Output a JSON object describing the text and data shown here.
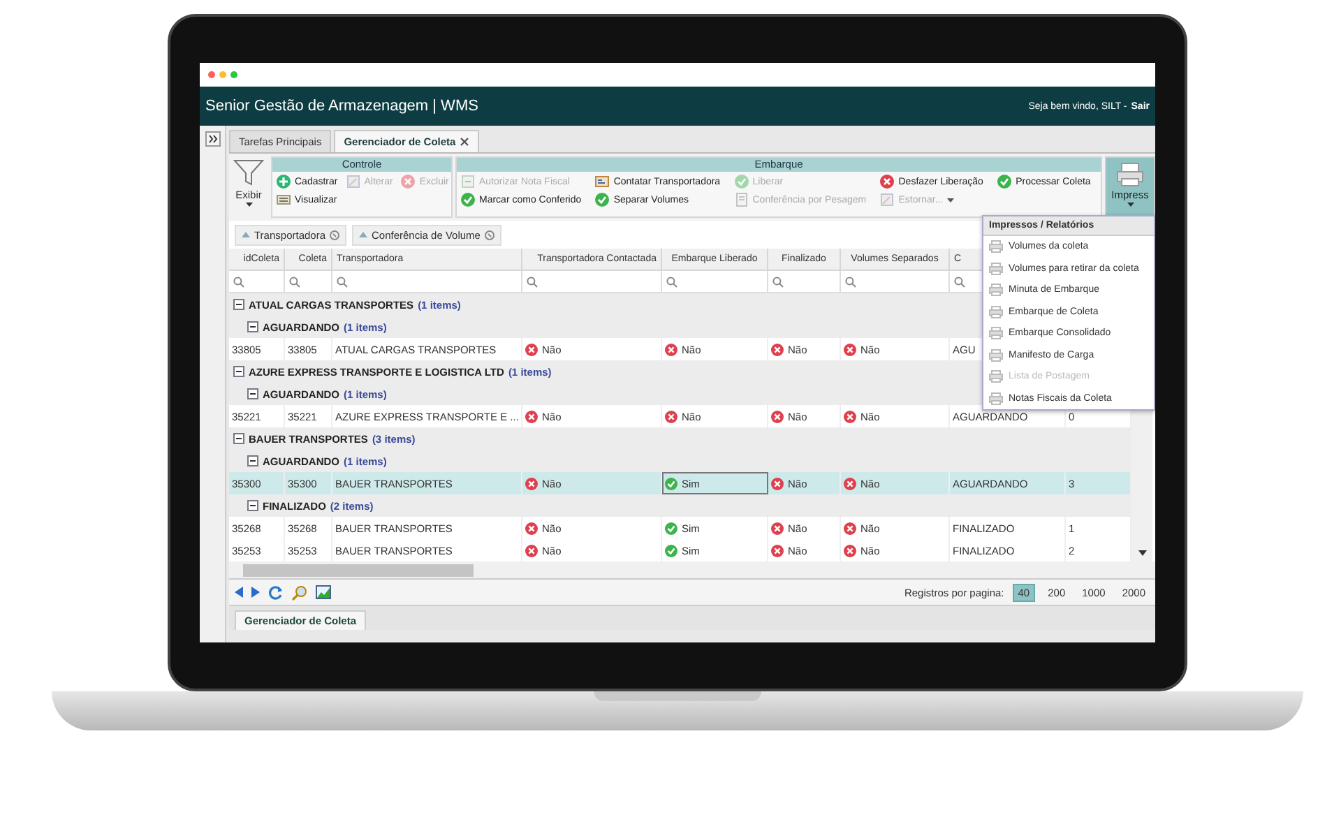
{
  "browser": {
    "dots": [
      {
        "color": "#ff5f57"
      },
      {
        "color": "#ffbd2e"
      },
      {
        "color": "#28c840"
      }
    ]
  },
  "app_header": {
    "title": "Senior Gestão de Armazenagem | WMS",
    "welcome": "Seja bem vindo, SILT -",
    "logout": "Sair"
  },
  "tabs": [
    {
      "label": "Tarefas Principais",
      "selected": false,
      "closable": false
    },
    {
      "label": "Gerenciador de Coleta",
      "selected": true,
      "closable": true
    }
  ],
  "toolbar": {
    "view_button": {
      "label": "Exibir"
    },
    "groups": [
      {
        "title": "Controle",
        "kind": "small",
        "actions": [
          {
            "label": "Cadastrar",
            "kind": "add",
            "disabled": false
          },
          {
            "label": "Alterar",
            "kind": "edit",
            "disabled": true
          },
          {
            "label": "Excluir",
            "kind": "remove",
            "disabled": true
          },
          {
            "label": "Visualizar",
            "kind": "view",
            "disabled": false
          }
        ]
      },
      {
        "title": "Embarque",
        "kind": "wide",
        "actions": [
          {
            "label": "Autorizar Nota Fiscal",
            "kind": "nota",
            "disabled": true
          },
          {
            "label": "Contatar Transportadora",
            "kind": "contact",
            "disabled": false
          },
          {
            "label": "Liberar",
            "kind": "check",
            "disabled": true
          },
          {
            "label": "Desfazer Liberação",
            "kind": "remove",
            "disabled": false
          },
          {
            "label": "Processar Coleta",
            "kind": "check",
            "disabled": false
          },
          {
            "label": "Marcar como Conferido",
            "kind": "check",
            "disabled": false
          },
          {
            "label": "Separar Volumes",
            "kind": "check",
            "disabled": false
          },
          {
            "label": "Conferência por Pesagem",
            "kind": "weigh",
            "disabled": true
          },
          {
            "label": "Estornar...",
            "kind": "edit",
            "disabled": true,
            "dropdown": true
          }
        ]
      }
    ],
    "print_button": {
      "label": "Impress",
      "expanded": true
    }
  },
  "print_menu": {
    "title": "Impressos / Relatórios",
    "items": [
      {
        "label": "Volumes da coleta",
        "disabled": false
      },
      {
        "label": "Volumes para retirar da coleta",
        "disabled": false
      },
      {
        "label": "Minuta de Embarque",
        "disabled": false
      },
      {
        "label": "Embarque de Coleta",
        "disabled": false
      },
      {
        "label": "Embarque Consolidado",
        "disabled": false
      },
      {
        "label": "Manifesto de Carga",
        "disabled": false
      },
      {
        "label": "Lista de Postagem",
        "disabled": true
      },
      {
        "label": "Notas Fiscais da Coleta",
        "disabled": false
      }
    ]
  },
  "grouping_chips": [
    {
      "label": "Transportadora"
    },
    {
      "label": "Conferência de Volume"
    }
  ],
  "table": {
    "columns": [
      {
        "label": "idColeta"
      },
      {
        "label": "Coleta"
      },
      {
        "label": "Transportadora"
      },
      {
        "label": "Transportadora Contactada"
      },
      {
        "label": "Embarque Liberado"
      },
      {
        "label": "Finalizado"
      },
      {
        "label": "Volumes Separados"
      },
      {
        "label": "C"
      }
    ],
    "groups": [
      {
        "name": "ATUAL CARGAS TRANSPORTES",
        "count": "(1 items)",
        "expanded": true,
        "children": [
          {
            "name": "AGUARDANDO",
            "count": "(1 items)",
            "expanded": true,
            "rows": [
              {
                "selected": false,
                "cells": [
                  {
                    "kind": "text",
                    "text": "33805"
                  },
                  {
                    "kind": "text",
                    "text": "33805"
                  },
                  {
                    "kind": "text",
                    "text": "ATUAL CARGAS TRANSPORTES"
                  },
                  {
                    "kind": "status",
                    "text": "Não",
                    "ok": false,
                    "focused": false
                  },
                  {
                    "kind": "status",
                    "text": "Não",
                    "ok": false,
                    "focused": false
                  },
                  {
                    "kind": "status",
                    "text": "Não",
                    "ok": false,
                    "focused": false
                  },
                  {
                    "kind": "status",
                    "text": "Não",
                    "ok": false,
                    "focused": false
                  },
                  {
                    "kind": "text",
                    "text": "AGU"
                  }
                ]
              }
            ]
          }
        ]
      },
      {
        "name": "AZURE EXPRESS TRANSPORTE E LOGISTICA LTD",
        "count": "(1 items)",
        "expanded": true,
        "children": [
          {
            "name": "AGUARDANDO",
            "count": "(1 items)",
            "expanded": true,
            "rows": [
              {
                "selected": false,
                "cells": [
                  {
                    "kind": "text",
                    "text": "35221"
                  },
                  {
                    "kind": "text",
                    "text": "35221"
                  },
                  {
                    "kind": "text",
                    "text": "AZURE EXPRESS TRANSPORTE E ..."
                  },
                  {
                    "kind": "status",
                    "text": "Não",
                    "ok": false,
                    "focused": false
                  },
                  {
                    "kind": "status",
                    "text": "Não",
                    "ok": false,
                    "focused": false
                  },
                  {
                    "kind": "status",
                    "text": "Não",
                    "ok": false,
                    "focused": false
                  },
                  {
                    "kind": "status",
                    "text": "Não",
                    "ok": false,
                    "focused": false
                  },
                  {
                    "kind": "text",
                    "text": "AGUARDANDO"
                  },
                  {
                    "kind": "text",
                    "text": "0"
                  }
                ]
              }
            ]
          }
        ]
      },
      {
        "name": "BAUER TRANSPORTES",
        "count": "(3 items)",
        "expanded": true,
        "children": [
          {
            "name": "AGUARDANDO",
            "count": "(1 items)",
            "expanded": true,
            "rows": [
              {
                "selected": true,
                "cells": [
                  {
                    "kind": "text",
                    "text": "35300"
                  },
                  {
                    "kind": "text",
                    "text": "35300"
                  },
                  {
                    "kind": "text",
                    "text": "BAUER TRANSPORTES"
                  },
                  {
                    "kind": "status",
                    "text": "Não",
                    "ok": false,
                    "focused": false
                  },
                  {
                    "kind": "status",
                    "text": "Sim",
                    "ok": true,
                    "focused": true
                  },
                  {
                    "kind": "status",
                    "text": "Não",
                    "ok": false,
                    "focused": false
                  },
                  {
                    "kind": "status",
                    "text": "Não",
                    "ok": false,
                    "focused": false
                  },
                  {
                    "kind": "text",
                    "text": "AGUARDANDO"
                  },
                  {
                    "kind": "text",
                    "text": "3"
                  }
                ]
              }
            ]
          },
          {
            "name": "FINALIZADO",
            "count": "(2 items)",
            "expanded": true,
            "rows": [
              {
                "selected": false,
                "cells": [
                  {
                    "kind": "text",
                    "text": "35268"
                  },
                  {
                    "kind": "text",
                    "text": "35268"
                  },
                  {
                    "kind": "text",
                    "text": "BAUER TRANSPORTES"
                  },
                  {
                    "kind": "status",
                    "text": "Não",
                    "ok": false,
                    "focused": false
                  },
                  {
                    "kind": "status",
                    "text": "Sim",
                    "ok": true,
                    "focused": false
                  },
                  {
                    "kind": "status",
                    "text": "Não",
                    "ok": false,
                    "focused": false
                  },
                  {
                    "kind": "status",
                    "text": "Não",
                    "ok": false,
                    "focused": false
                  },
                  {
                    "kind": "text",
                    "text": "FINALIZADO"
                  },
                  {
                    "kind": "text",
                    "text": "1"
                  }
                ]
              },
              {
                "selected": false,
                "cells": [
                  {
                    "kind": "text",
                    "text": "35253"
                  },
                  {
                    "kind": "text",
                    "text": "35253"
                  },
                  {
                    "kind": "text",
                    "text": "BAUER TRANSPORTES"
                  },
                  {
                    "kind": "status",
                    "text": "Não",
                    "ok": false,
                    "focused": false
                  },
                  {
                    "kind": "status",
                    "text": "Sim",
                    "ok": true,
                    "focused": false
                  },
                  {
                    "kind": "status",
                    "text": "Não",
                    "ok": false,
                    "focused": false
                  },
                  {
                    "kind": "status",
                    "text": "Não",
                    "ok": false,
                    "focused": false
                  },
                  {
                    "kind": "text",
                    "text": "FINALIZADO"
                  },
                  {
                    "kind": "text",
                    "text": "2"
                  }
                ]
              }
            ]
          }
        ]
      }
    ]
  },
  "pager": {
    "label": "Registros por pagina:",
    "sizes": [
      {
        "label": "40",
        "selected": true
      },
      {
        "label": "200",
        "selected": false
      },
      {
        "label": "1000",
        "selected": false
      },
      {
        "label": "2000",
        "selected": false
      }
    ]
  },
  "bottom_tabs": [
    {
      "label": "Gerenciador de Coleta",
      "selected": true
    }
  ]
}
